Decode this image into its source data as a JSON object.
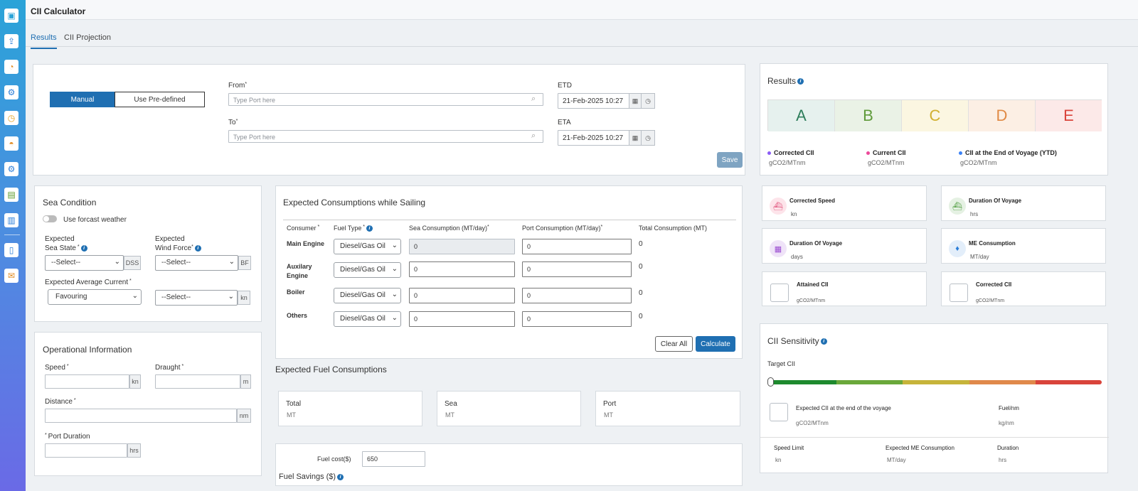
{
  "app": {
    "title": "CII Calculator"
  },
  "tabs": [
    {
      "label": "Results"
    },
    {
      "label": "CII Projection"
    }
  ],
  "route": {
    "mode_manual": "Manual",
    "mode_predefined": "Use Pre-defined",
    "from_label": "From",
    "from_placeholder": "Type Port here",
    "to_label": "To",
    "to_placeholder": "Type Port here",
    "etd_label": "ETD",
    "etd_value": "21-Feb-2025 10:27",
    "eta_label": "ETA",
    "eta_value": "21-Feb-2025 10:27",
    "save_label": "Save"
  },
  "sea": {
    "title": "Sea Condition",
    "toggle_label": "Use forcast weather",
    "sea_state_label1": "Expected",
    "sea_state_label2": "Sea State",
    "wind_label1": "Expected",
    "wind_label2": "Wind Force",
    "select_placeholder": "--Select--",
    "dss_unit": "DSS",
    "bf_unit": "BF",
    "current_label": "Expected Average Current",
    "current_value": "Favouring",
    "current_speed": "--Select--",
    "kn_unit": "kn"
  },
  "ops": {
    "title": "Operational Information",
    "speed_label": "Speed",
    "speed_unit": "kn",
    "draught_label": "Draught",
    "draught_unit": "m",
    "distance_label": "Distance",
    "distance_unit": "nm",
    "port_label": "Port Duration",
    "port_unit": "hrs"
  },
  "consumption": {
    "title": "Expected Consumptions while Sailing",
    "headers": {
      "consumer": "Consumer",
      "fuel": "Fuel Type",
      "sea": "Sea Consumption (MT/day)",
      "port": "Port Consumption (MT/day)",
      "total": "Total Consumption (MT)"
    },
    "rows": [
      {
        "consumer": "Main Engine",
        "fuel": "Diesel/Gas Oil",
        "sea": "0",
        "port": "0",
        "total": "0"
      },
      {
        "consumer": "Auxilary Engine",
        "fuel": "Diesel/Gas Oil",
        "sea": "0",
        "port": "0",
        "total": "0"
      },
      {
        "consumer": "Boiler",
        "fuel": "Diesel/Gas Oil",
        "sea": "0",
        "port": "0",
        "total": "0"
      },
      {
        "consumer": "Others",
        "fuel": "Diesel/Gas Oil",
        "sea": "0",
        "port": "0",
        "total": "0"
      }
    ],
    "clear_label": "Clear All",
    "calculate_label": "Calculate"
  },
  "fuel": {
    "title": "Expected Fuel Consumptions",
    "total_label": "Total",
    "total_unit": "MT",
    "sea_label": "Sea",
    "sea_unit": "MT",
    "port_label": "Port",
    "port_unit": "MT",
    "cost_label": "Fuel cost($)",
    "cost_value": "650",
    "savings_label": "Fuel Savings ($)"
  },
  "results": {
    "title": "Results",
    "grades": [
      "A",
      "B",
      "C",
      "D",
      "E"
    ],
    "grade_colors": [
      "#e6f1ee",
      "#eaf2e6",
      "#fbf6e1",
      "#fcefe4",
      "#fce9e8"
    ],
    "grade_text_colors": [
      "#2e7d5b",
      "#5f9a3a",
      "#d1b030",
      "#e08a45",
      "#d9443b"
    ],
    "legend": [
      {
        "label": "Corrected CII",
        "unit": "gCO2/MTnm",
        "color": "#8b5cf6"
      },
      {
        "label": "Current CII",
        "unit": "gCO2/MTnm",
        "color": "#ec4899"
      },
      {
        "label": "CII at the End of Voyage (YTD)",
        "unit": "gCO2/MTnm",
        "color": "#3b82f6"
      }
    ]
  },
  "cards": [
    {
      "title": "Corrected Speed",
      "unit": "kn",
      "icon": "ship-icon"
    },
    {
      "title": "Duration Of Voyage",
      "unit": "hrs",
      "icon": "clock-ship-icon"
    },
    {
      "title": "Duration Of Voyage",
      "unit": "days",
      "icon": "calendar-icon"
    },
    {
      "title": "ME Consumption",
      "unit": "MT/day",
      "icon": "drop-icon"
    },
    {
      "title": "Attained CII",
      "unit": "gCO2/MTnm",
      "icon": ""
    },
    {
      "title": "Corrected CII",
      "unit": "gCO2/MTnm",
      "icon": ""
    }
  ],
  "sensitivity": {
    "title": "CII Sensitivity",
    "target_label": "Target CII",
    "bar_colors": [
      "#1e8a2e",
      "#6aa83a",
      "#c6b43a",
      "#e0894b",
      "#d9443b"
    ],
    "expected_label": "Expected CII at the end of the voyage",
    "expected_unit": "gCO2/MTnm",
    "fuelnm_label": "Fuel/nm",
    "fuelnm_unit": "kg/nm",
    "speed_limit_label": "Speed Limit",
    "speed_limit_unit": "kn",
    "me_label": "Expected ME Consumption",
    "me_unit": "MT/day",
    "duration_label": "Duration",
    "duration_unit": "hrs"
  }
}
